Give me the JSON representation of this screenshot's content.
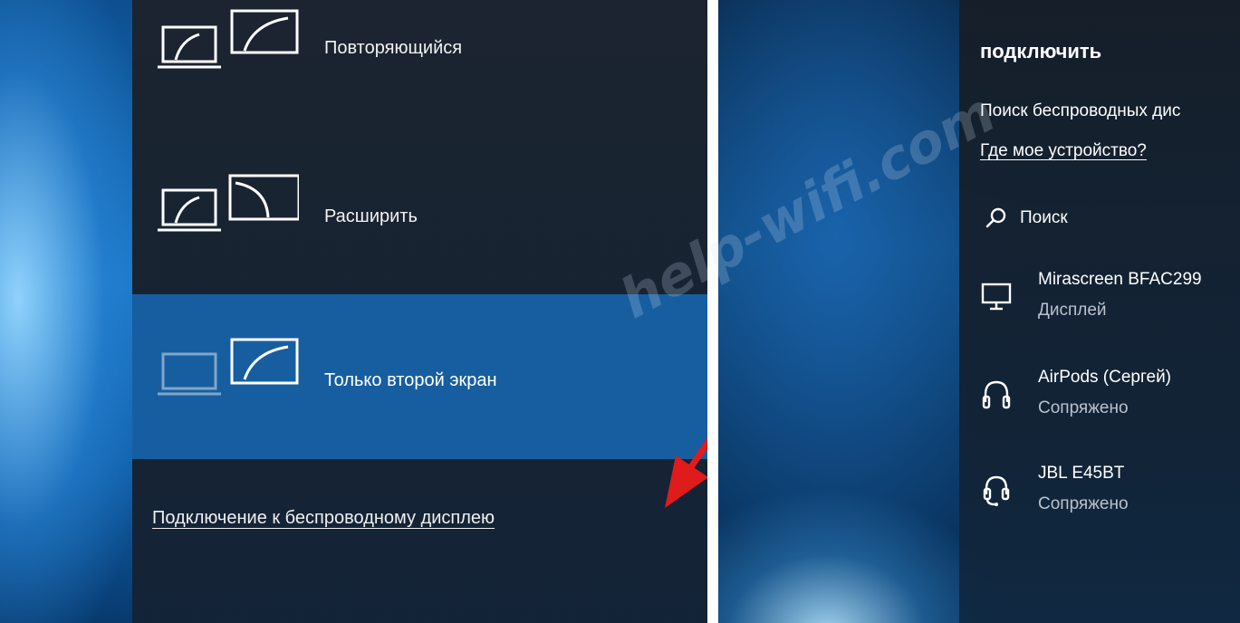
{
  "project_panel": {
    "modes": [
      {
        "label": "Повторяющийся",
        "icon": "duplicate-display-icon",
        "selected": false
      },
      {
        "label": "Расширить",
        "icon": "extend-display-icon",
        "selected": false
      },
      {
        "label": "Только второй экран",
        "icon": "second-screen-only-icon",
        "selected": true
      }
    ],
    "wireless_link": "Подключение к беспроводному дисплею"
  },
  "connect_panel": {
    "title": "подключить",
    "search_status": "Поиск беспроводных дис",
    "help_link": "Где мое устройство?",
    "search_label": "Поиск",
    "devices": [
      {
        "name": "Mirascreen BFAC299",
        "status": "Дисплей",
        "icon": "monitor-icon"
      },
      {
        "name": "AirPods (Сергей)",
        "status": "Сопряжено",
        "icon": "headphones-icon"
      },
      {
        "name": "JBL E45BT",
        "status": "Сопряжено",
        "icon": "headset-icon"
      }
    ]
  },
  "watermark": "help-wifi.com",
  "colors": {
    "panel_bg": "#1c222c",
    "selected_row": "#175ea0",
    "arrow": "#e01b1b",
    "text": "#ffffff"
  }
}
